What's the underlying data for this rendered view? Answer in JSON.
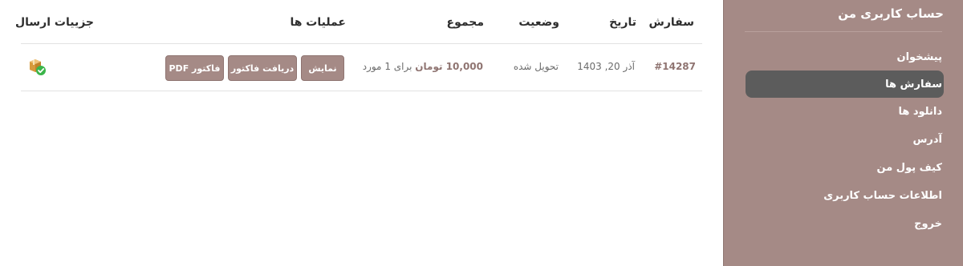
{
  "sidebar": {
    "title": "حساب کاربری من",
    "items": [
      {
        "label": "پیشخوان",
        "active": false
      },
      {
        "label": "سفارش ها",
        "active": true
      },
      {
        "label": "دانلود ها",
        "active": false
      },
      {
        "label": "آدرس",
        "active": false
      },
      {
        "label": "کیف پول من",
        "active": false
      },
      {
        "label": "اطلاعات حساب کاربری",
        "active": false
      },
      {
        "label": "خروج",
        "active": false
      }
    ]
  },
  "table": {
    "headers": {
      "order": "سفارش",
      "date": "تاریخ",
      "status": "وضعیت",
      "total": "مجموع",
      "actions": "عملیات ها",
      "shipping": "جزییات ارسال"
    },
    "rows": [
      {
        "order": "#14287",
        "date": "آذر 20, 1403",
        "status": "تحویل شده",
        "total_amount": "10,000 تومان",
        "total_suffix": "برای 1 مورد",
        "actions": {
          "view": "نمایش",
          "get_invoice": "دریافت فاکتور",
          "pdf_invoice": "فاکتور PDF"
        },
        "shipping_icon": "package-delivered-icon"
      }
    ]
  },
  "colors": {
    "brand": "#a58a86",
    "active_item": "#5c5c5c",
    "delivered_check": "#3bb54a"
  }
}
